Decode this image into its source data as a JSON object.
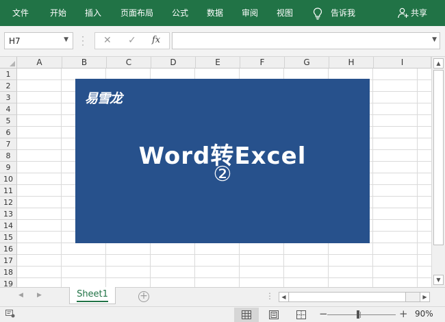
{
  "ribbon": {
    "tabs": [
      "文件",
      "开始",
      "插入",
      "页面布局",
      "公式",
      "数据",
      "审阅",
      "视图"
    ],
    "tell_me": "告诉我",
    "share": "共享",
    "background_color": "#217346"
  },
  "formula_bar": {
    "name_box": "H7",
    "formula": ""
  },
  "grid": {
    "columns": [
      "A",
      "B",
      "C",
      "D",
      "E",
      "F",
      "G",
      "H",
      "I"
    ],
    "rows": [
      "1",
      "2",
      "3",
      "4",
      "5",
      "6",
      "7",
      "8",
      "9",
      "10",
      "11",
      "12",
      "13",
      "14",
      "15",
      "16",
      "17",
      "18",
      "19"
    ]
  },
  "banner": {
    "brand": "易雪龙",
    "title": "Word转Excel",
    "subtitle": "②",
    "background_color": "#27518c"
  },
  "sheets": {
    "tabs": [
      "Sheet1"
    ],
    "active": "Sheet1"
  },
  "status_bar": {
    "zoom": "90%"
  }
}
